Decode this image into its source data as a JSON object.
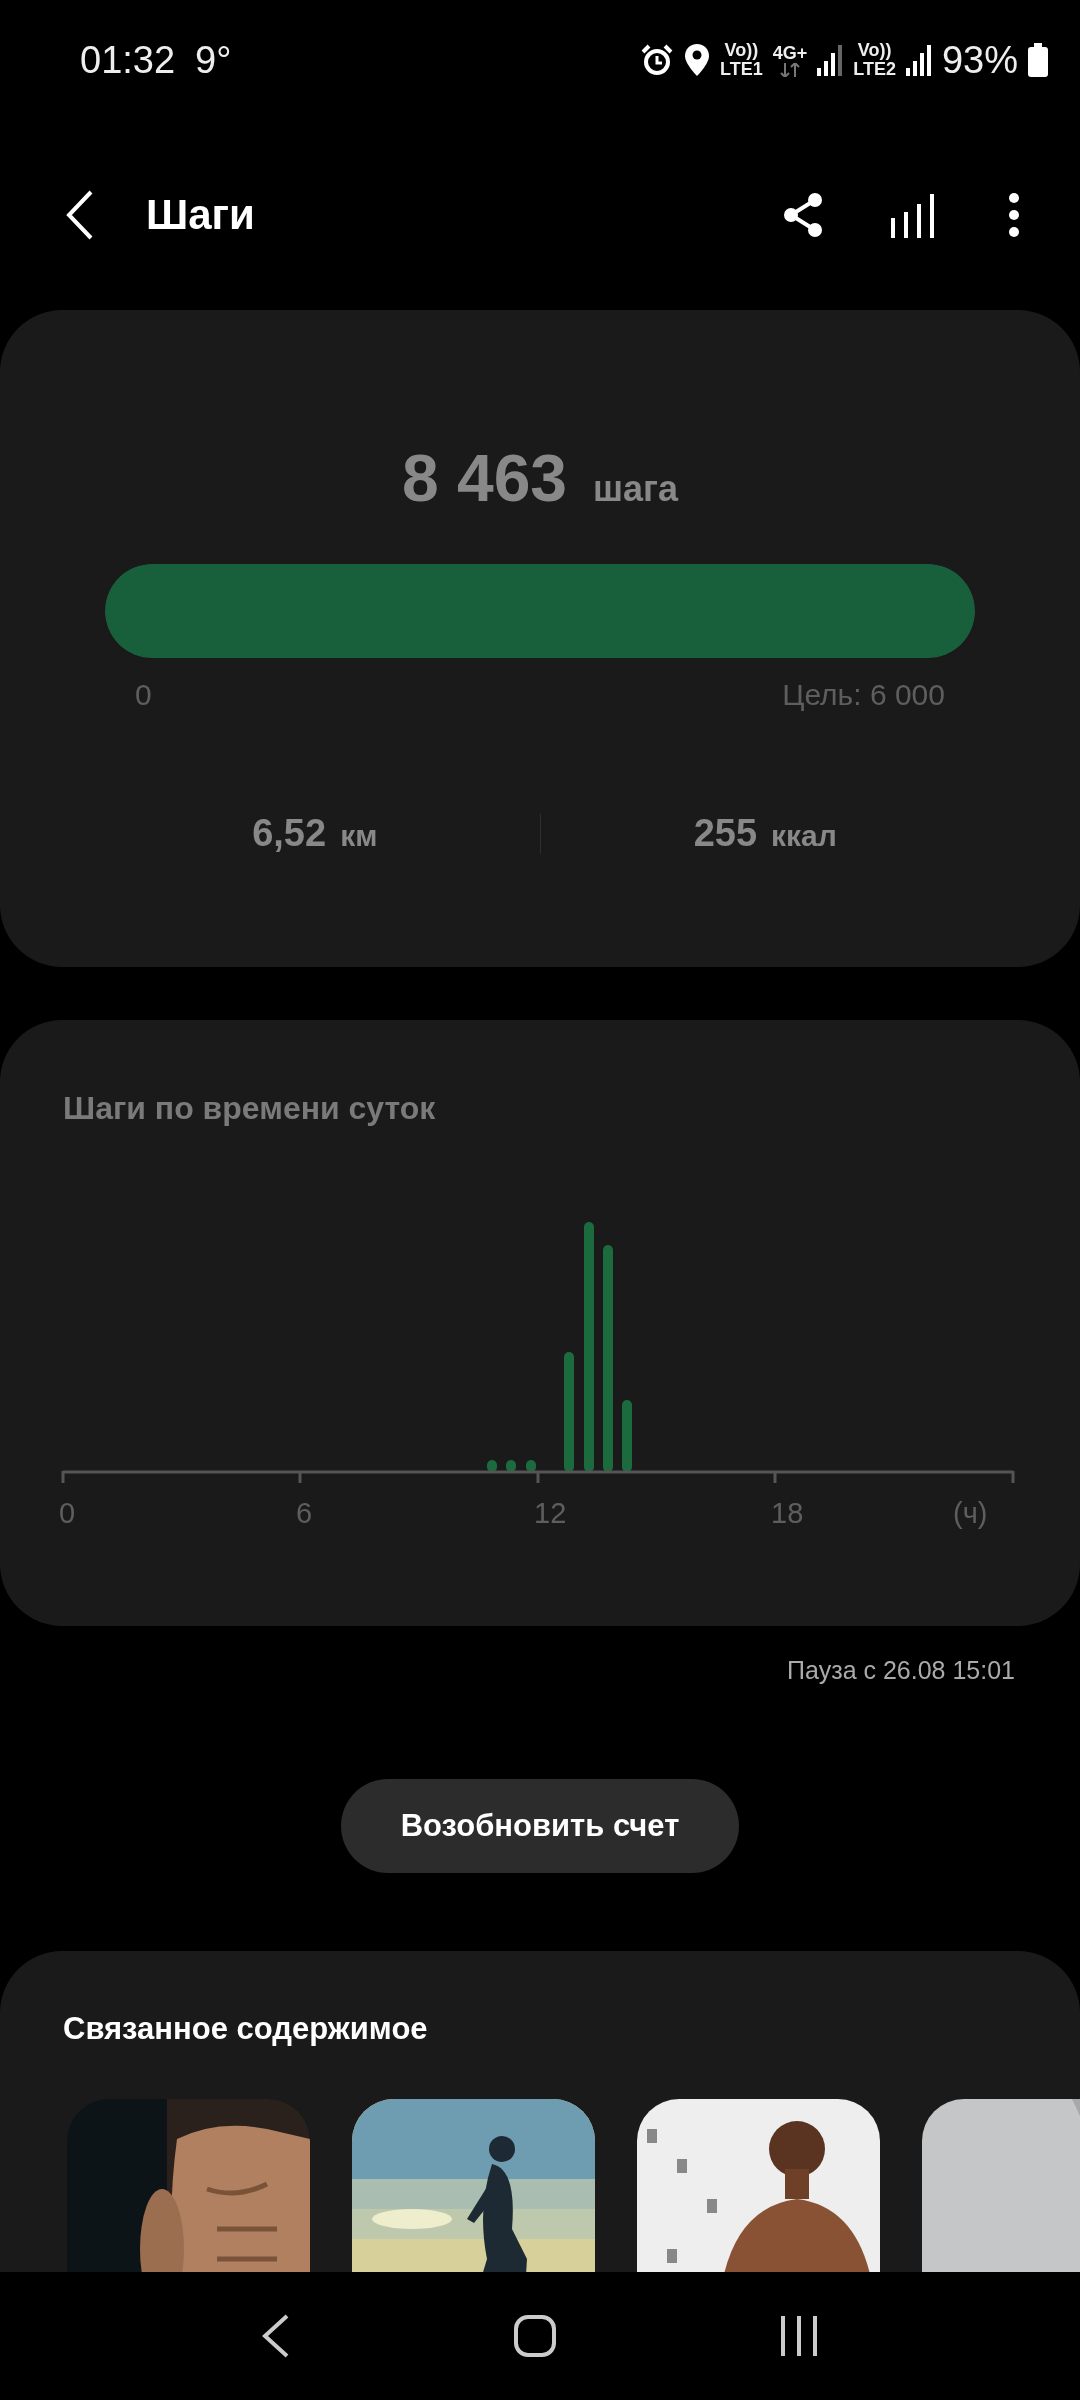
{
  "status_bar": {
    "time": "01:32",
    "temperature": "9°",
    "sim1": {
      "volte": "Vo))",
      "network": "LTE1"
    },
    "data": "4G+",
    "sim2": {
      "volte": "Vo))",
      "network": "LTE2"
    },
    "battery": "93%"
  },
  "header": {
    "title": "Шаги"
  },
  "summary": {
    "count": "8 463",
    "unit": "шага",
    "progress": {
      "level": 1,
      "start": "0",
      "goal": "Цель: 6 000"
    },
    "stats": [
      {
        "value": "6,52",
        "unit": "км"
      },
      {
        "value": "255",
        "unit": "ккал"
      }
    ]
  },
  "timeline": {
    "title": "Шаги по времени суток",
    "axis_labels": [
      "0",
      "6",
      "12",
      "18",
      "(ч)"
    ]
  },
  "pause_note": "Пауза с 26.08 15:01",
  "resume_button": "Возобновить счет",
  "related": {
    "title": "Связанное содержимое"
  }
}
